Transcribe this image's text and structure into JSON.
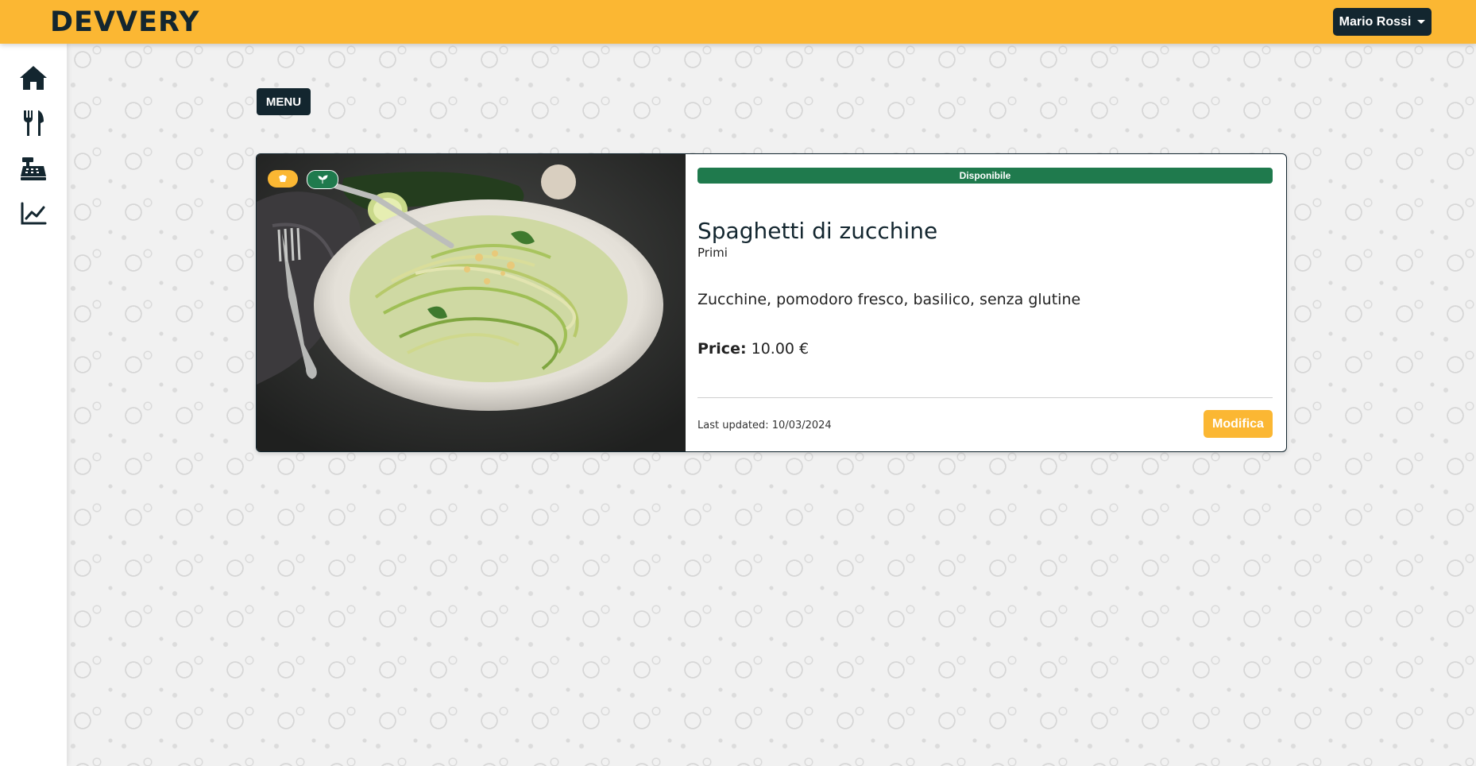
{
  "header": {
    "logo_text": "DEVVERY",
    "user_name": "Mario Rossi"
  },
  "sidebar": {
    "items": [
      {
        "name": "home",
        "icon": "home-icon"
      },
      {
        "name": "menu",
        "icon": "utensils-icon"
      },
      {
        "name": "cash-register",
        "icon": "cash-register-icon"
      },
      {
        "name": "statistics",
        "icon": "chart-line-icon"
      }
    ]
  },
  "main": {
    "section_label": "MENU",
    "dish": {
      "status": "Disponibile",
      "name": "Spaghetti di zucchine",
      "category": "Primi",
      "description": "Zucchine, pomodoro fresco, basilico, senza glutine",
      "price_label": "Price:",
      "price_value": "10.00 €",
      "last_updated": "Last updated: 10/03/2024",
      "edit_label": "Modifica",
      "tags": [
        {
          "icon": "chef-hat-icon",
          "color": "#fbb733"
        },
        {
          "icon": "seedling-icon",
          "color": "#1f7a4d"
        }
      ]
    }
  },
  "colors": {
    "brand_yellow": "#fbb733",
    "dark_navy": "#13262f",
    "available_green": "#1f7a4d"
  }
}
